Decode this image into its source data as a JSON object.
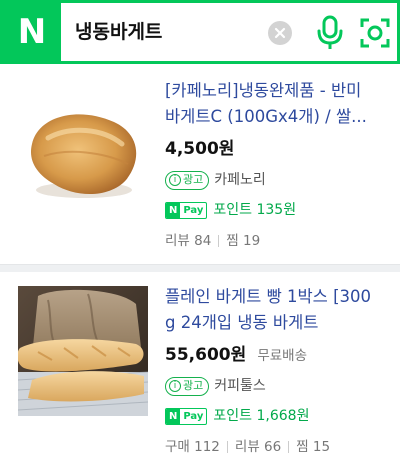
{
  "search": {
    "logo_text": "N",
    "query": "냉동바게트",
    "clear_icon": "close-icon",
    "mic_icon": "microphone-icon",
    "lens_icon": "smart-lens-icon"
  },
  "colors": {
    "brand_green": "#03c75a",
    "title_blue": "#2e4a9e",
    "divider_gray": "#eef0f2"
  },
  "products": [
    {
      "title_line1": "[카페노리]냉동완제품 - 반미",
      "title_line2": "바게트C (100Gx4개) / 쌀...",
      "price": "4,500원",
      "shipping": "",
      "ad_label": "광고",
      "mall": "카페노리",
      "npay_n": "N",
      "npay_pay": "Pay",
      "points": "포인트 135원",
      "stats": [
        {
          "label": "리뷰 84"
        },
        {
          "label": "찜 19"
        }
      ]
    },
    {
      "title_line1": "플레인 바게트 빵 1박스 [300",
      "title_line2": "g 24개입 냉동 바게트",
      "price": "55,600원",
      "shipping": "무료배송",
      "ad_label": "광고",
      "mall": "커피툴스",
      "npay_n": "N",
      "npay_pay": "Pay",
      "points": "포인트 1,668원",
      "stats": [
        {
          "label": "구매 112"
        },
        {
          "label": "리뷰 66"
        },
        {
          "label": "찜 15"
        }
      ]
    }
  ]
}
